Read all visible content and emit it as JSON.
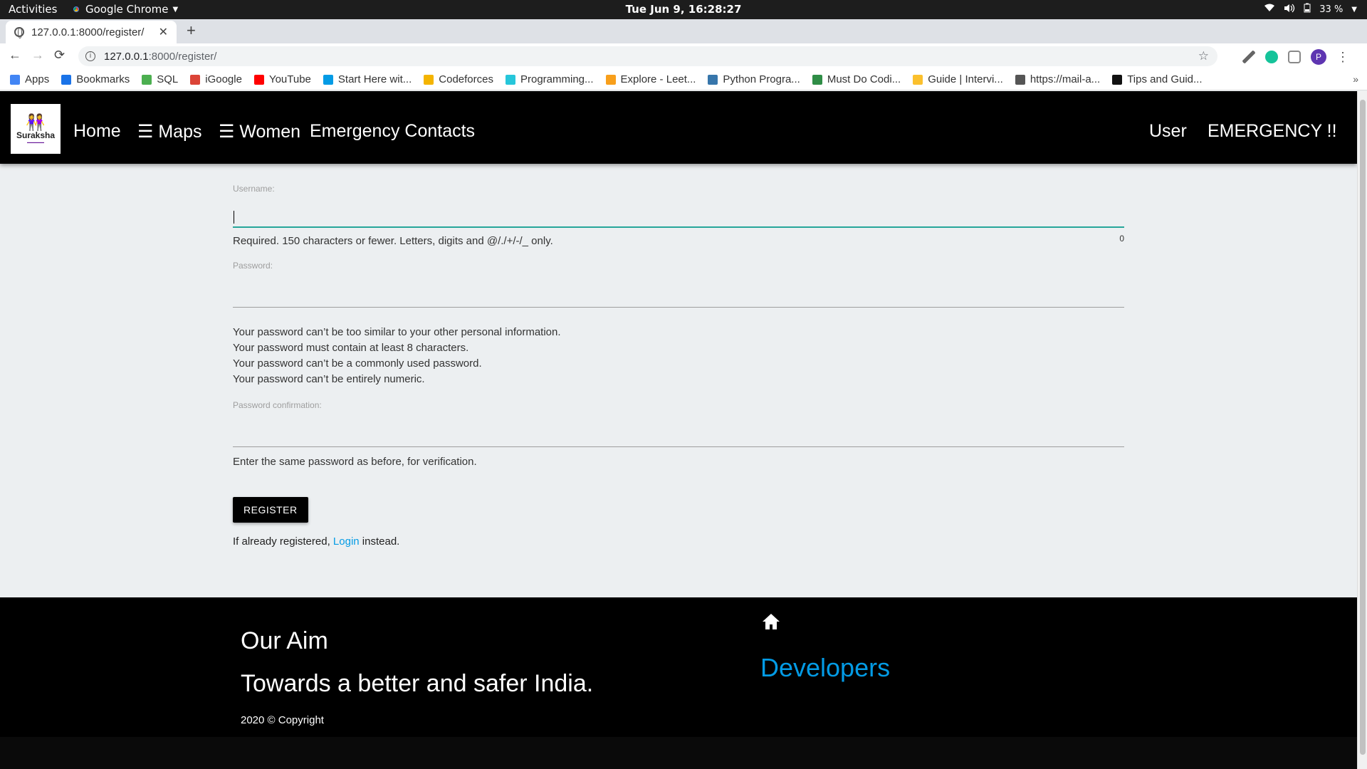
{
  "os": {
    "activities": "Activities",
    "app_name": "Google Chrome",
    "clock": "Tue Jun  9, 16:28:27",
    "battery": "33 %"
  },
  "browser": {
    "tab_title": "127.0.0.1:8000/register/",
    "url_host": "127.0.0.1",
    "url_path": ":8000/register/",
    "profile_initial": "P",
    "bookmarks": [
      {
        "label": "Apps",
        "icon": "apps-grid-icon",
        "color": "#4285f4"
      },
      {
        "label": "Bookmarks",
        "icon": "star-icon",
        "color": "#1a73e8"
      },
      {
        "label": "SQL",
        "icon": "sql-icon",
        "color": "#4caf50"
      },
      {
        "label": "iGoogle",
        "icon": "google-icon",
        "color": "#db4437"
      },
      {
        "label": "YouTube",
        "icon": "youtube-icon",
        "color": "#ff0000"
      },
      {
        "label": "Start Here wit...",
        "icon": "p-icon",
        "color": "#039be5"
      },
      {
        "label": "Codeforces",
        "icon": "codeforces-icon",
        "color": "#f4b400"
      },
      {
        "label": "Programming...",
        "icon": "beta-icon",
        "color": "#26c6da"
      },
      {
        "label": "Explore - Leet...",
        "icon": "leetcode-icon",
        "color": "#f89f1b"
      },
      {
        "label": "Python Progra...",
        "icon": "python-icon",
        "color": "#3776ab"
      },
      {
        "label": "Must Do Codi...",
        "icon": "gfg-icon",
        "color": "#2f8d46"
      },
      {
        "label": "Guide | Intervi...",
        "icon": "folder-icon",
        "color": "#fbc02d"
      },
      {
        "label": "https://mail-a...",
        "icon": "globe-icon",
        "color": "#555555"
      },
      {
        "label": "Tips and Guid...",
        "icon": "hackerearth-icon",
        "color": "#111111"
      }
    ]
  },
  "site": {
    "brand": "Suraksha",
    "nav": {
      "home": "Home",
      "maps": "☰ Maps",
      "women": "☰ Women",
      "emergency_contacts": "Emergency Contacts",
      "user": "User",
      "emergency": "EMERGENCY !!"
    },
    "form": {
      "username_label": "Username:",
      "username_value": "",
      "username_help": "Required. 150 characters or fewer. Letters, digits and @/./+/-/_ only.",
      "username_counter": "0",
      "password_label": "Password:",
      "password_help": [
        "Your password can’t be too similar to your other personal information.",
        "Your password must contain at least 8 characters.",
        "Your password can’t be a commonly used password.",
        "Your password can’t be entirely numeric."
      ],
      "password_confirm_label": "Password confirmation:",
      "password_confirm_help": "Enter the same password as before, for verification.",
      "register_button": "Register",
      "login_prefix": "If already registered,",
      "login_link": "Login",
      "login_suffix": "instead."
    },
    "footer": {
      "aim_title": "Our Aim",
      "aim_text": "Towards a better and safer India.",
      "copyright": "2020 © Copyright",
      "developers": "Developers"
    }
  }
}
